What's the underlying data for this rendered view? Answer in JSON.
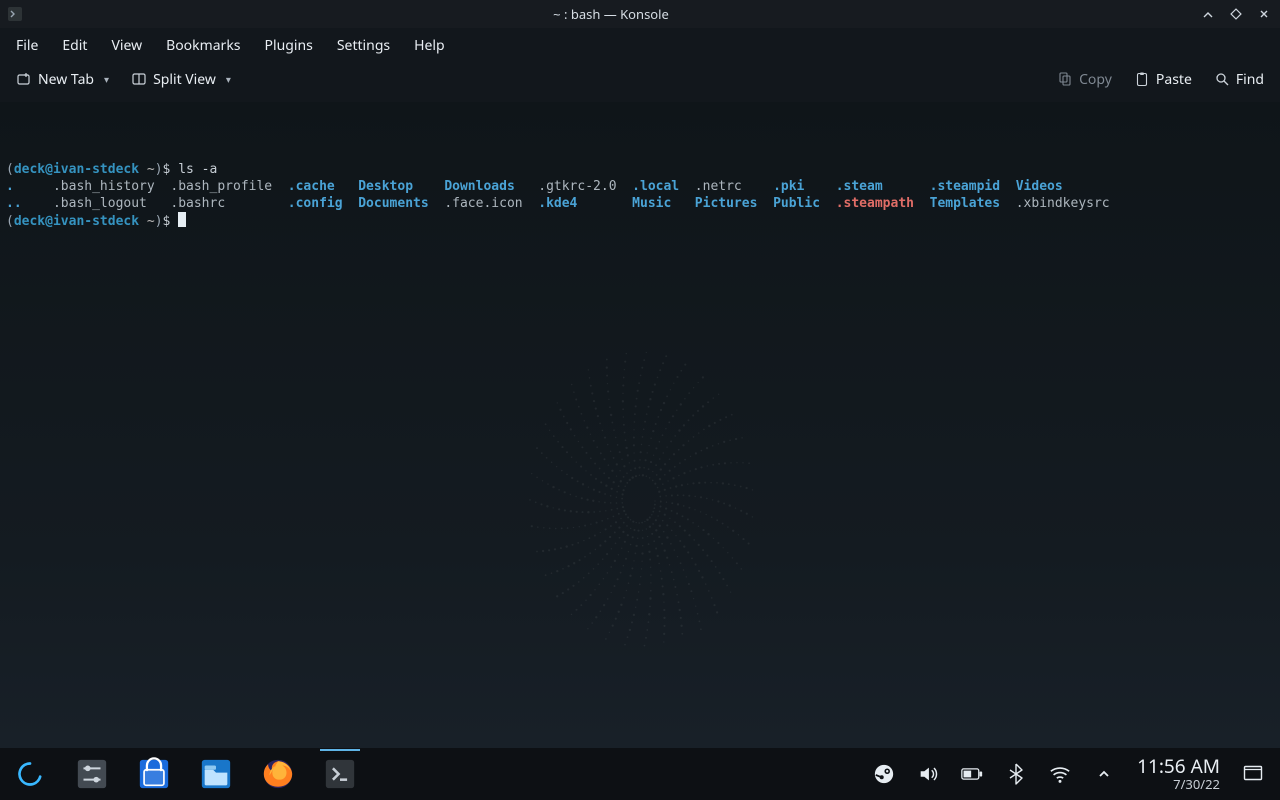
{
  "titlebar": {
    "title": "~ : bash — Konsole"
  },
  "menubar": {
    "items": [
      "File",
      "Edit",
      "View",
      "Bookmarks",
      "Plugins",
      "Settings",
      "Help"
    ]
  },
  "toolbar": {
    "newtab": "New Tab",
    "splitview": "Split View",
    "copy": "Copy",
    "paste": "Paste",
    "find": "Find"
  },
  "terminal": {
    "prompt_user": "deck@ivan-stdeck",
    "prompt_path": "~",
    "command": "ls -a",
    "columns": [
      [
        {
          "t": ".",
          "c": "dirblue"
        },
        {
          "t": "..",
          "c": "dirblue"
        }
      ],
      [
        {
          "t": ".bash_history",
          "c": "plain"
        },
        {
          "t": ".bash_logout",
          "c": "plain"
        }
      ],
      [
        {
          "t": ".bash_profile",
          "c": "plain"
        },
        {
          "t": ".bashrc",
          "c": "plain"
        }
      ],
      [
        {
          "t": ".cache",
          "c": "dirblue"
        },
        {
          "t": ".config",
          "c": "dirblue"
        }
      ],
      [
        {
          "t": "Desktop",
          "c": "dirblue"
        },
        {
          "t": "Documents",
          "c": "dirblue"
        }
      ],
      [
        {
          "t": "Downloads",
          "c": "dirblue"
        },
        {
          "t": ".face.icon",
          "c": "plain"
        }
      ],
      [
        {
          "t": ".gtkrc-2.0",
          "c": "plain"
        },
        {
          "t": ".kde4",
          "c": "dirblue"
        }
      ],
      [
        {
          "t": ".local",
          "c": "dirblue"
        },
        {
          "t": "Music",
          "c": "dirblue"
        }
      ],
      [
        {
          "t": ".netrc",
          "c": "plain"
        },
        {
          "t": "Pictures",
          "c": "dirblue"
        }
      ],
      [
        {
          "t": ".pki",
          "c": "dirblue"
        },
        {
          "t": "Public",
          "c": "dirblue"
        }
      ],
      [
        {
          "t": ".steam",
          "c": "dirblue"
        },
        {
          "t": ".steampath",
          "c": "broken"
        }
      ],
      [
        {
          "t": ".steampid",
          "c": "symlink"
        },
        {
          "t": "Templates",
          "c": "dirblue"
        }
      ],
      [
        {
          "t": "Videos",
          "c": "dirblue"
        },
        {
          "t": ".xbindkeysrc",
          "c": "plain"
        }
      ]
    ]
  },
  "tray": {
    "time": "11:56 AM",
    "date": "7/30/22"
  },
  "taskbar_apps": [
    "steam-deck-menu",
    "system-settings",
    "discover-store",
    "file-manager",
    "firefox",
    "konsole"
  ]
}
